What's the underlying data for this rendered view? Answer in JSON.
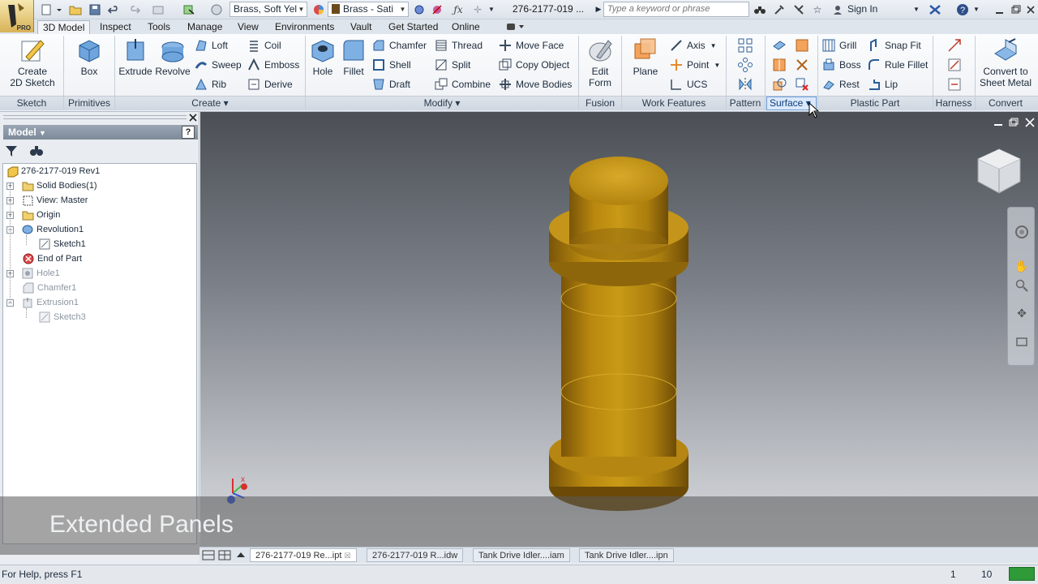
{
  "app": {
    "logo_badge": "PRO"
  },
  "titlebar": {
    "material": "Brass, Soft Yel",
    "appearance": "Brass - Sati",
    "document_title": "276-2177-019 ...",
    "search_placeholder": "Type a keyword or phrase",
    "sign_in": "Sign In"
  },
  "tabs": [
    "3D Model",
    "Inspect",
    "Tools",
    "Manage",
    "View",
    "Environments",
    "Vault",
    "Get Started",
    "Online"
  ],
  "ribbon": {
    "sketch": {
      "create_2d_sketch": "Create\n2D Sketch",
      "panel": "Sketch"
    },
    "primitives": {
      "box": "Box",
      "panel": "Primitives"
    },
    "create": {
      "extrude": "Extrude",
      "revolve": "Revolve",
      "loft": "Loft",
      "sweep": "Sweep",
      "rib": "Rib",
      "coil": "Coil",
      "emboss": "Emboss",
      "derive": "Derive",
      "panel": "Create"
    },
    "modify": {
      "hole": "Hole",
      "fillet": "Fillet",
      "chamfer": "Chamfer",
      "shell": "Shell",
      "draft": "Draft",
      "thread": "Thread",
      "split": "Split",
      "combine": "Combine",
      "move_face": "Move Face",
      "copy_object": "Copy Object",
      "move_bodies": "Move Bodies",
      "panel": "Modify"
    },
    "fusion": {
      "edit_form": "Edit\nForm",
      "panel": "Fusion"
    },
    "work_features": {
      "plane": "Plane",
      "axis": "Axis",
      "point": "Point",
      "ucs": "UCS",
      "panel": "Work Features"
    },
    "pattern": {
      "panel": "Pattern"
    },
    "surface": {
      "panel": "Surface"
    },
    "plastic_part": {
      "grill": "Grill",
      "boss": "Boss",
      "rest": "Rest",
      "snap_fit": "Snap Fit",
      "rule_fillet": "Rule Fillet",
      "lip": "Lip",
      "panel": "Plastic Part"
    },
    "harness": {
      "panel": "Harness"
    },
    "convert": {
      "convert_to_sheet_metal": "Convert to\nSheet Metal",
      "panel": "Convert"
    }
  },
  "browser": {
    "title": "Model",
    "tree": [
      {
        "label": "276-2177-019 Rev1",
        "icon": "part-icon"
      },
      {
        "label": "Solid Bodies(1)",
        "icon": "folder-icon"
      },
      {
        "label": "View: Master",
        "icon": "view-icon"
      },
      {
        "label": "Origin",
        "icon": "folder-icon"
      },
      {
        "label": "Revolution1",
        "icon": "revolve-feature-icon"
      },
      {
        "label": "Sketch1",
        "icon": "sketch-icon"
      },
      {
        "label": "End of Part",
        "icon": "end-of-part-icon"
      },
      {
        "label": "Hole1",
        "icon": "hole-feature-icon"
      },
      {
        "label": "Chamfer1",
        "icon": "chamfer-feature-icon"
      },
      {
        "label": "Extrusion1",
        "icon": "extrude-feature-icon"
      },
      {
        "label": "Sketch3",
        "icon": "sketch-icon"
      }
    ]
  },
  "overlay": {
    "caption": "Extended Panels"
  },
  "doc_tabs": [
    "276-2177-019 Re...ipt",
    "276-2177-019 R...idw",
    "Tank Drive Idler....iam",
    "Tank Drive Idler....ipn"
  ],
  "status": {
    "help": "For Help, press F1",
    "count1": "1",
    "count2": "10"
  },
  "colors": {
    "brass": "#b98a16",
    "accent": "#2d6fc4",
    "status_green": "#2e9a38"
  }
}
